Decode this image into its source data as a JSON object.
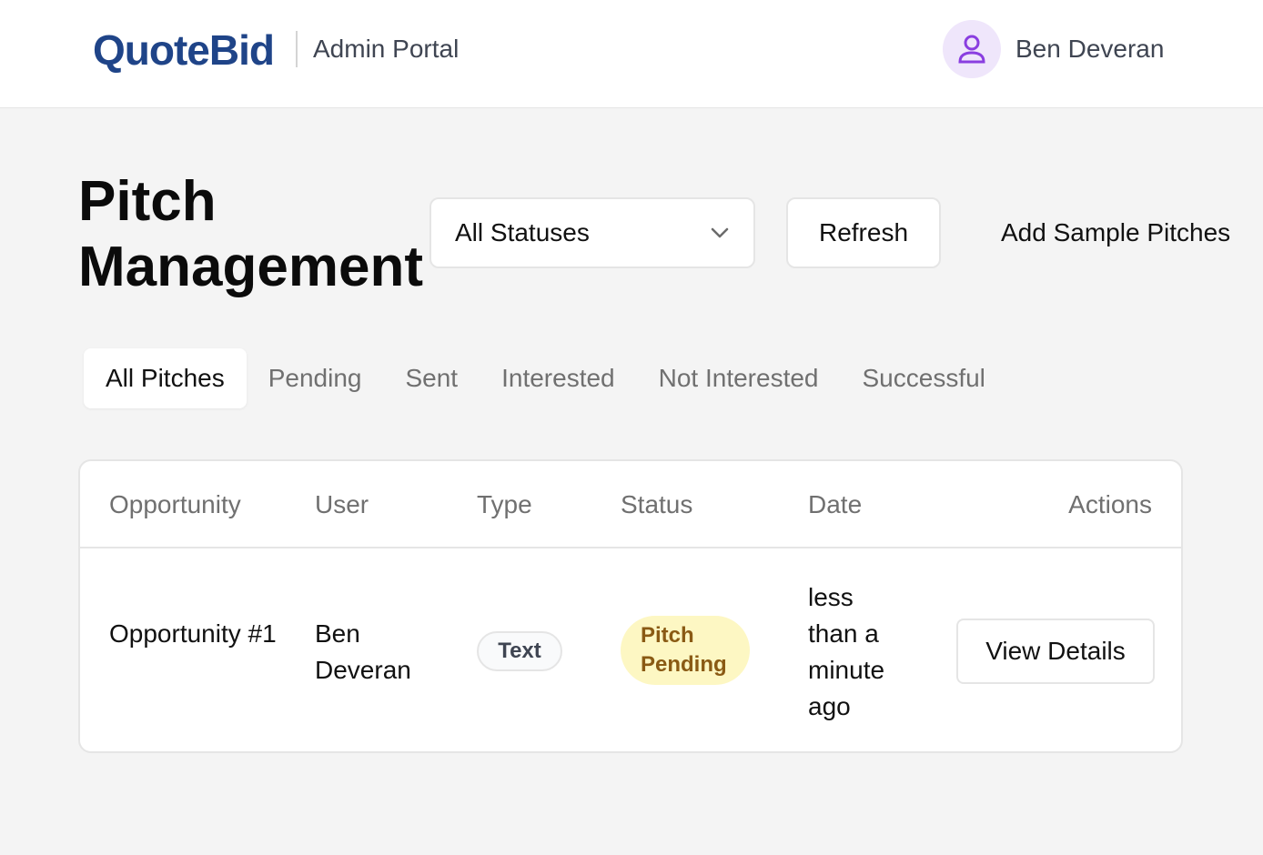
{
  "header": {
    "logo": "QuoteBid",
    "portal_label": "Admin Portal",
    "user_name": "Ben Deveran",
    "avatar_icon": "user-icon",
    "logo_color": "#1f4488",
    "avatar_color": "#8a3ee0"
  },
  "page": {
    "title": "Pitch Management"
  },
  "toolbar": {
    "status_filter": "All Statuses",
    "refresh_label": "Refresh",
    "add_sample_label": "Add Sample Pitches"
  },
  "tabs": [
    {
      "label": "All Pitches",
      "active": true
    },
    {
      "label": "Pending",
      "active": false
    },
    {
      "label": "Sent",
      "active": false
    },
    {
      "label": "Interested",
      "active": false
    },
    {
      "label": "Not Interested",
      "active": false
    },
    {
      "label": "Successful",
      "active": false
    }
  ],
  "table": {
    "columns": [
      "Opportunity",
      "User",
      "Type",
      "Status",
      "Date",
      "Actions"
    ],
    "rows": [
      {
        "opportunity": "Opportunity #1",
        "user": "Ben Deveran",
        "type": "Text",
        "status": "Pitch Pending",
        "date": "less than a minute ago",
        "action_label": "View Details"
      }
    ]
  }
}
